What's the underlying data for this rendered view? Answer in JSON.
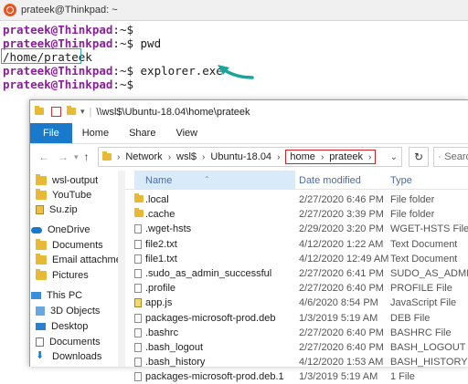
{
  "terminal": {
    "title": "prateek@Thinkpad: ~",
    "lines": [
      {
        "prompt": "prateek@Thinkpad",
        "rest": ":~$"
      },
      {
        "prompt": "prateek@Thinkpad",
        "rest": ":~$ pwd"
      },
      {
        "prompt": "",
        "rest": "/home/prateek"
      },
      {
        "prompt": "prateek@Thinkpad",
        "rest": ":~$ explorer.exe ."
      },
      {
        "prompt": "prateek@Thinkpad",
        "rest": ":~$"
      }
    ]
  },
  "explorer": {
    "title": "\\\\wsl$\\Ubuntu-18.04\\home\\prateek",
    "ribbon_tabs": [
      "File",
      "Home",
      "Share",
      "View"
    ],
    "breadcrumb": [
      "Network",
      "wsl$",
      "Ubuntu-18.04",
      "home",
      "prateek"
    ],
    "search_placeholder": "Search pr",
    "columns": {
      "name": "Name",
      "date": "Date modified",
      "type": "Type"
    },
    "sidebar": [
      {
        "label": "wsl-output",
        "icon": "folder-icon"
      },
      {
        "label": "YouTube",
        "icon": "folder-icon"
      },
      {
        "label": "Su.zip",
        "icon": "zip-icon"
      },
      {
        "label": "OneDrive",
        "icon": "cloud-icon"
      },
      {
        "label": "Documents",
        "icon": "folder-icon"
      },
      {
        "label": "Email attachmer",
        "icon": "folder-icon"
      },
      {
        "label": "Pictures",
        "icon": "folder-icon"
      },
      {
        "label": "This PC",
        "icon": "pc-icon"
      },
      {
        "label": "3D Objects",
        "icon": "cube-icon"
      },
      {
        "label": "Desktop",
        "icon": "desktop-icon"
      },
      {
        "label": "Documents",
        "icon": "document-icon"
      },
      {
        "label": "Downloads",
        "icon": "download-icon"
      }
    ],
    "files": [
      {
        "name": ".local",
        "date": "2/27/2020 6:46 PM",
        "type": "File folder",
        "icon": "folder"
      },
      {
        "name": ".cache",
        "date": "2/27/2020 3:39 PM",
        "type": "File folder",
        "icon": "folder"
      },
      {
        "name": ".wget-hsts",
        "date": "2/29/2020 3:20 PM",
        "type": "WGET-HSTS File",
        "icon": "doc"
      },
      {
        "name": "file2.txt",
        "date": "4/12/2020 1:22 AM",
        "type": "Text Document",
        "icon": "doc"
      },
      {
        "name": "file1.txt",
        "date": "4/12/2020 12:49 AM",
        "type": "Text Document",
        "icon": "doc"
      },
      {
        "name": ".sudo_as_admin_successful",
        "date": "2/27/2020 6:41 PM",
        "type": "SUDO_AS_ADMIN...",
        "icon": "doc"
      },
      {
        "name": ".profile",
        "date": "2/27/2020 6:40 PM",
        "type": "PROFILE File",
        "icon": "doc"
      },
      {
        "name": "app.js",
        "date": "4/6/2020 8:54 PM",
        "type": "JavaScript File",
        "icon": "js"
      },
      {
        "name": "packages-microsoft-prod.deb",
        "date": "1/3/2019 5:19 AM",
        "type": "DEB File",
        "icon": "doc"
      },
      {
        "name": ".bashrc",
        "date": "2/27/2020 6:40 PM",
        "type": "BASHRC File",
        "icon": "doc"
      },
      {
        "name": ".bash_logout",
        "date": "2/27/2020 6:40 PM",
        "type": "BASH_LOGOUT File",
        "icon": "doc"
      },
      {
        "name": ".bash_history",
        "date": "4/12/2020 1:53 AM",
        "type": "BASH_HISTORY File",
        "icon": "doc"
      },
      {
        "name": "packages-microsoft-prod.deb.1",
        "date": "1/3/2019 5:19 AM",
        "type": "1 File",
        "icon": "doc"
      }
    ],
    "colors": {
      "file_tab": "#1979ca",
      "highlight_box": "#d32020",
      "path_box": "#29a7b5",
      "prompt": "#8a1f9a"
    }
  }
}
